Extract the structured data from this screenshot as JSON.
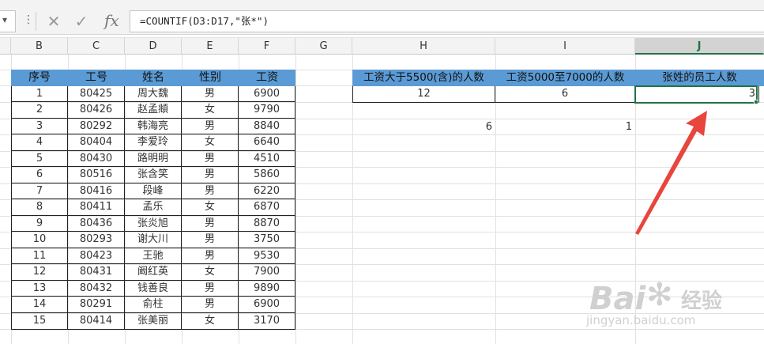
{
  "formula_bar": {
    "name_box_arrow": "▾",
    "menu_dots": "⋮",
    "cancel_glyph": "✕",
    "confirm_glyph": "✓",
    "fx_label": "fx",
    "formula": "=COUNTIF(D3:D17,\"张*\")"
  },
  "columns": [
    "B",
    "C",
    "D",
    "E",
    "F",
    "G",
    "H",
    "I",
    "J"
  ],
  "selected_column": "J",
  "table": {
    "headers": [
      "序号",
      "工号",
      "姓名",
      "性别",
      "工资"
    ],
    "rows": [
      [
        "1",
        "80425",
        "周大魏",
        "男",
        "6900"
      ],
      [
        "2",
        "80426",
        "赵孟頫",
        "女",
        "9790"
      ],
      [
        "3",
        "80292",
        "韩海亮",
        "男",
        "8840"
      ],
      [
        "4",
        "80404",
        "李爱玲",
        "女",
        "6640"
      ],
      [
        "5",
        "80430",
        "路明明",
        "男",
        "4510"
      ],
      [
        "6",
        "80516",
        "张含笑",
        "男",
        "5860"
      ],
      [
        "7",
        "80416",
        "段峰",
        "男",
        "6220"
      ],
      [
        "8",
        "80411",
        "孟乐",
        "女",
        "6870"
      ],
      [
        "9",
        "80436",
        "张炎旭",
        "男",
        "8870"
      ],
      [
        "10",
        "80293",
        "谢大川",
        "男",
        "3750"
      ],
      [
        "11",
        "80423",
        "王驰",
        "男",
        "9530"
      ],
      [
        "12",
        "80431",
        "阚红英",
        "女",
        "7900"
      ],
      [
        "13",
        "80432",
        "钱善良",
        "男",
        "9890"
      ],
      [
        "14",
        "80291",
        "俞柱",
        "男",
        "6900"
      ],
      [
        "15",
        "80414",
        "张美丽",
        "女",
        "3170"
      ]
    ]
  },
  "summary": {
    "headers": [
      "工资大于5500(含)的人数",
      "工资5000至7000的人数",
      "张姓的员工人数"
    ],
    "values": [
      "12",
      "6",
      "3"
    ]
  },
  "extra_values": {
    "h5": "6",
    "i5": "1"
  },
  "accent_colors": {
    "header_fill": "#5b9bd5",
    "selection": "#217346",
    "arrow": "#e8453c"
  },
  "watermark": {
    "brand": "Bai",
    "brand2": "经验",
    "url": "jingyan.baidu.com"
  }
}
